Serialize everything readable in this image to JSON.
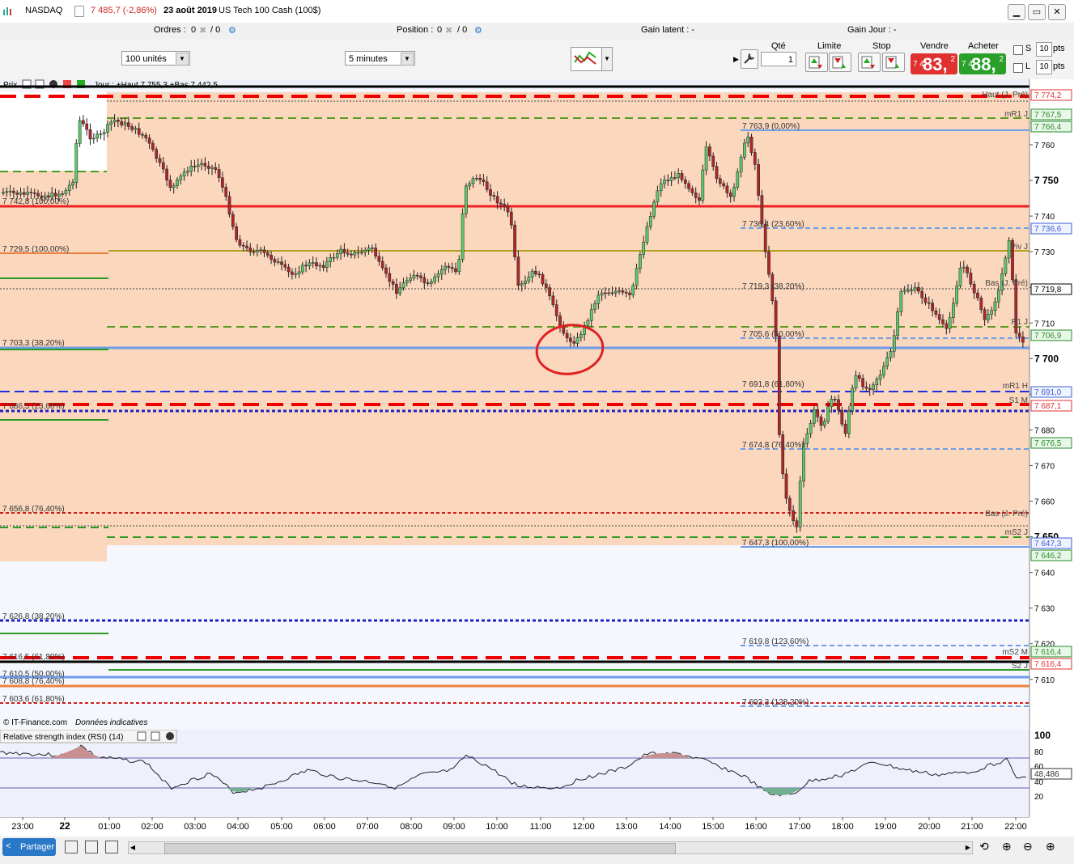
{
  "window": {
    "instrument": "NASDAQ",
    "price_change": "7 485,7 (-2,86%)",
    "date": "23 août 2019",
    "market_name": "US Tech 100 Cash (100$)"
  },
  "orderbar": {
    "ordres_label": "Ordres :",
    "ordres_value": "0",
    "position_label": "Position :",
    "position_value": "0",
    "slash_zero": "/ 0",
    "gain_latent": "Gain latent : -",
    "gain_jour": "Gain Jour : -"
  },
  "toolbar": {
    "units": "100 unités",
    "interval": "5 minutes",
    "qte_label": "Qté",
    "qte_value": "1",
    "limite_label": "Limite",
    "stop_label": "Stop",
    "vendre_label": "Vendre",
    "acheter_label": "Acheter",
    "sell_small": "7 4",
    "sell_big": "83,",
    "sell_exp": "2",
    "buy_small": "7 4",
    "buy_big": "88,",
    "buy_exp": "2",
    "s_label": "S",
    "l_label": "L",
    "pts_value": "10",
    "pts_label": "pts"
  },
  "colors": {
    "sell": "#e03030",
    "buy": "#2aa02a",
    "candle_up": "#5cc96b",
    "candle_down": "#b0262b",
    "zone_top": "#fad7bd",
    "zone_bottom": "#e8eefa"
  },
  "chart": {
    "header_label": "Prix",
    "header_info": "Jour : +Haut 7 755,3 +Bas 7 442,5",
    "footer_credit": "© IT-Finance.com",
    "footer_note": "Données indicatives",
    "y_ticks": [
      "7 760",
      "7 750",
      "7 740",
      "7 730",
      "7 720",
      "7 710",
      "7 700",
      "7 690",
      "7 680",
      "7 670",
      "7 660",
      "7 650",
      "7 640",
      "7 630",
      "7 620",
      "7 610"
    ],
    "bold_ticks": [
      "7 750",
      "7 700",
      "7 650"
    ],
    "price_tags": [
      {
        "text": "7 774,2",
        "type": "red"
      },
      {
        "text": "7 767,5",
        "type": "green"
      },
      {
        "text": "7 766,4",
        "type": "green"
      },
      {
        "text": "7 736,6",
        "type": "blue"
      },
      {
        "text": "7 719,8",
        "type": "black"
      },
      {
        "text": "7 706,9",
        "type": "green"
      },
      {
        "text": "7 691,0",
        "type": "blue"
      },
      {
        "text": "7 687,1",
        "type": "red"
      },
      {
        "text": "7 676,5",
        "type": "green"
      },
      {
        "text": "7 647,3",
        "type": "blue"
      },
      {
        "text": "7 646,2",
        "type": "green"
      },
      {
        "text": "7 616,4",
        "type": "green"
      },
      {
        "text": "7 616,4",
        "type": "red"
      },
      {
        "text": "48,486",
        "type": "gray"
      }
    ],
    "line_labels": [
      "Haut (J. Pré)",
      "mR1 J",
      "Piv J",
      "Bas (J. Pré)",
      "R1 J",
      "mR1 H",
      "S1 M",
      "Bas (J. Pré)",
      "mS2 J",
      "mS2 M",
      "S2 J"
    ],
    "fib_left": [
      "7 742,8 (100,00%)",
      "7 729,5 (100,00%)",
      "7 703,3 (38,20%)",
      "7 686,5 (23,60%)",
      "7 656,8 (76,40%)",
      "7 626,8 (38,20%)",
      "7 616,5 (61,80%)",
      "7 610,5 (50,00%)",
      "7 608,8 (76,40%)",
      "7 603,6 (61,80%)"
    ],
    "fib_right": [
      "7 763,9 (0,00%)",
      "7 736,4 (23,60%)",
      "7 719,3 (38,20%)",
      "7 705,6 (50,00%)",
      "7 691,8 (61,80%)",
      "7 674,8 (76,40%)",
      "7 647,3 (100,00%)",
      "7 619,8 (123,60%)",
      "7 602,3 (128,20%)"
    ]
  },
  "rsi": {
    "label": "Relative strength index (RSI) (14)",
    "ticks": [
      "100",
      "80",
      "60",
      "40",
      "20"
    ],
    "value": "48,486"
  },
  "time_axis": [
    "23:00",
    "22",
    "01:00",
    "02:00",
    "03:00",
    "04:00",
    "05:00",
    "06:00",
    "07:00",
    "08:00",
    "09:00",
    "10:00",
    "11:00",
    "12:00",
    "13:00",
    "14:00",
    "15:00",
    "16:00",
    "17:00",
    "18:00",
    "19:00",
    "20:00",
    "21:00",
    "22:00"
  ],
  "bottombar": {
    "share_label": "Partager"
  }
}
